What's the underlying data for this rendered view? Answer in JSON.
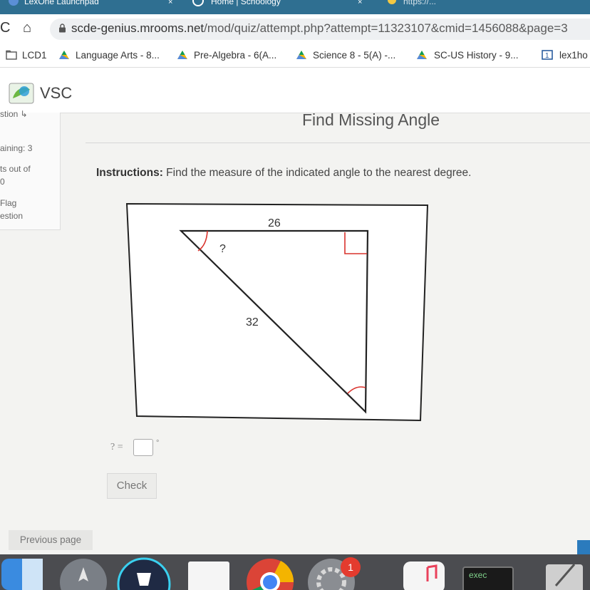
{
  "tabs": [
    {
      "label": "LexOne Launchpad",
      "close": "×"
    },
    {
      "label": "Home | Schoology",
      "close": "×"
    },
    {
      "label": "https://..."
    }
  ],
  "nav": {
    "reload": "C",
    "home": "⌂"
  },
  "url": {
    "host": "scde-genius.mrooms.net",
    "path": "/mod/quiz/attempt.php?attempt=11323107&cmid=1456088&page=3"
  },
  "bookmarks": [
    "LCD1",
    "Language Arts - 8...",
    "Pre-Algebra - 6(A...",
    "Science 8 - 5(A) -...",
    "SC-US History - 9...",
    "lex1ho"
  ],
  "site": {
    "logo_text": "VSC"
  },
  "sidebar": {
    "items": [
      "stion ↳",
      "aining: 3",
      "ts out of",
      "0",
      "Flag",
      "estion"
    ]
  },
  "quiz": {
    "title": "Find Missing Angle",
    "instructions_label": "Instructions:",
    "instructions_text": " Find the measure of the indicated angle to the nearest degree.",
    "diagram": {
      "side_top": "26",
      "hypotenuse": "32",
      "unknown_angle": "?"
    },
    "answer_prompt": "? =",
    "degree_symbol": "°",
    "check_label": "Check",
    "previous_page_label": "Previous page"
  },
  "dock": {
    "badge_count": "1",
    "exec_label": "exec"
  },
  "colors": {
    "tabbar": "#2f6f91",
    "angle_mark": "#d9322c",
    "dock": "#4b4c50",
    "badge": "#e43b2e"
  }
}
